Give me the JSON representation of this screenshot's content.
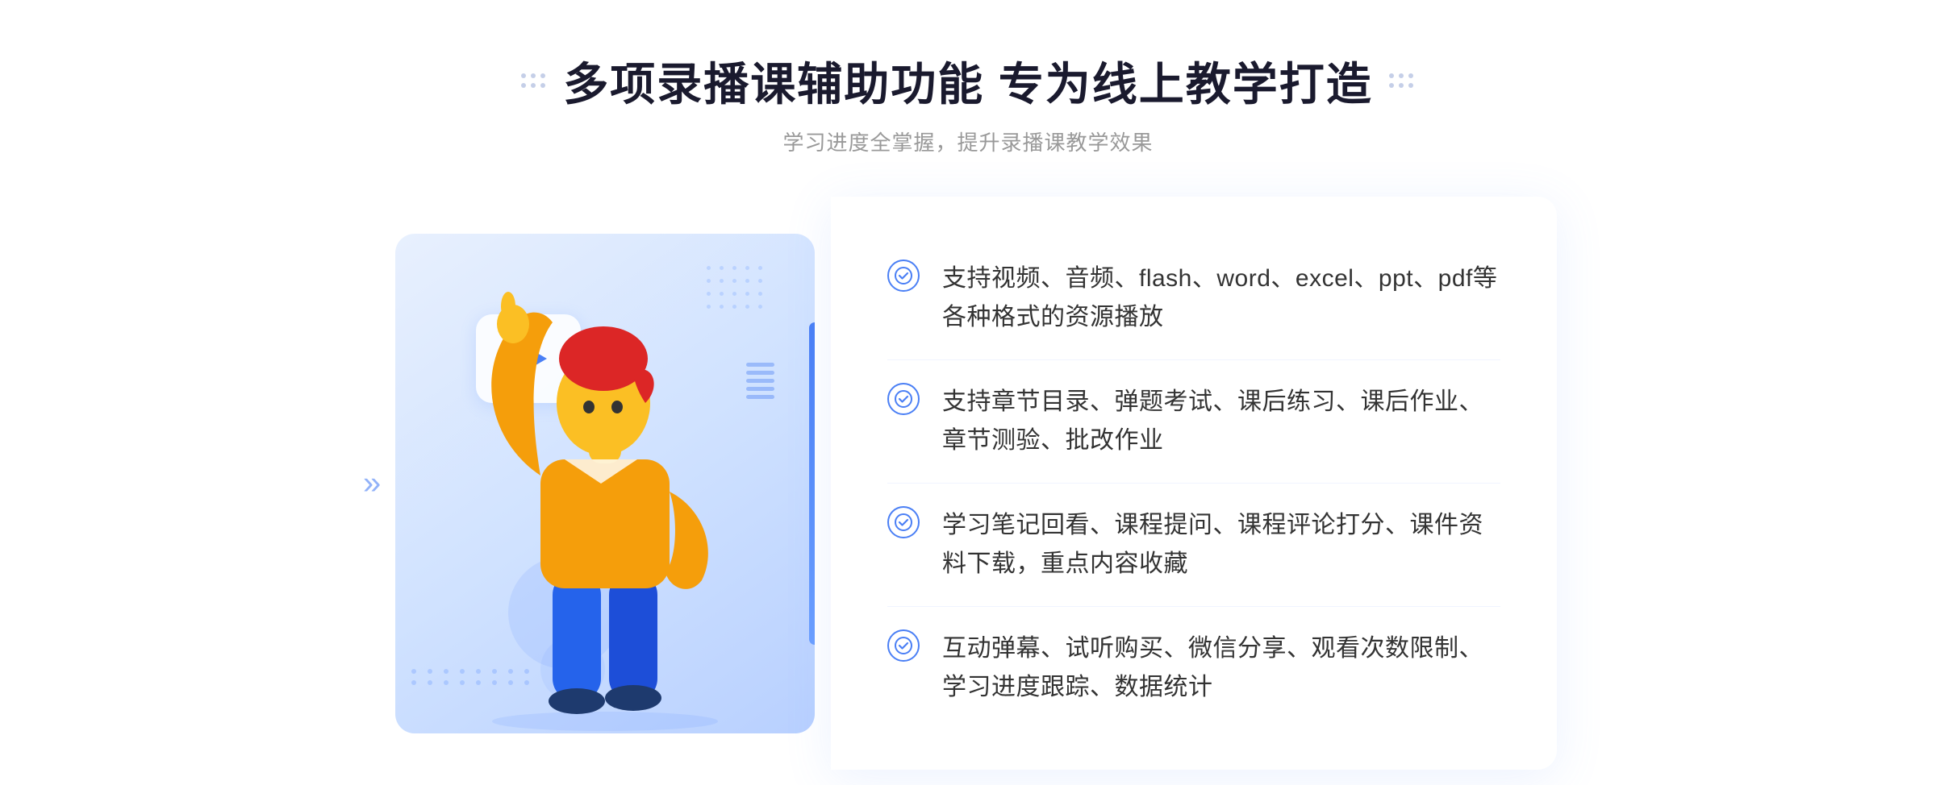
{
  "page": {
    "bg_color": "#ffffff"
  },
  "header": {
    "title": "多项录播课辅助功能 专为线上教学打造",
    "subtitle": "学习进度全掌握，提升录播课教学效果"
  },
  "decorative": {
    "dots_left": "⋮⋮",
    "dots_right": "⋮⋮",
    "left_arrow": "»",
    "accent_color": "#4a7ff5"
  },
  "features": [
    {
      "id": 1,
      "text": "支持视频、音频、flash、word、excel、ppt、pdf等各种格式的资源播放"
    },
    {
      "id": 2,
      "text": "支持章节目录、弹题考试、课后练习、课后作业、章节测验、批改作业"
    },
    {
      "id": 3,
      "text": "学习笔记回看、课程提问、课程评论打分、课件资料下载，重点内容收藏"
    },
    {
      "id": 4,
      "text": "互动弹幕、试听购买、微信分享、观看次数限制、学习进度跟踪、数据统计"
    }
  ]
}
